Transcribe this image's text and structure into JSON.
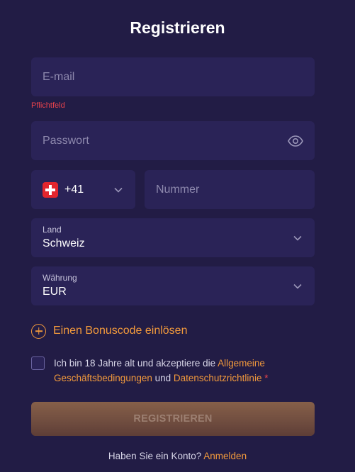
{
  "form": {
    "title": "Registrieren",
    "email": {
      "placeholder": "E-mail",
      "value": "",
      "error": "Pflichtfeld"
    },
    "password": {
      "placeholder": "Passwort",
      "value": ""
    },
    "phone": {
      "country_flag": "switzerland-flag-icon",
      "code": "+41",
      "placeholder": "Nummer",
      "value": ""
    },
    "country": {
      "label": "Land",
      "value": "Schweiz"
    },
    "currency": {
      "label": "Währung",
      "value": "EUR"
    },
    "bonus": {
      "label": "Einen Bonuscode einlösen"
    },
    "terms": {
      "checked": false,
      "text_before": "Ich bin 18 Jahre alt und akzeptiere die ",
      "link_terms": "Allgemeine Geschäftsbedingungen",
      "text_mid": " und ",
      "link_privacy": "Datenschutzrichtlinie",
      "required_mark": " *"
    },
    "submit_label": "REGISTRIEREN",
    "login": {
      "prompt": "Haben Sie ein Konto?",
      "link": "Anmelden"
    }
  },
  "colors": {
    "background": "#221c45",
    "field": "#2a2357",
    "accent": "#f39a3c",
    "error": "#e8434c"
  }
}
